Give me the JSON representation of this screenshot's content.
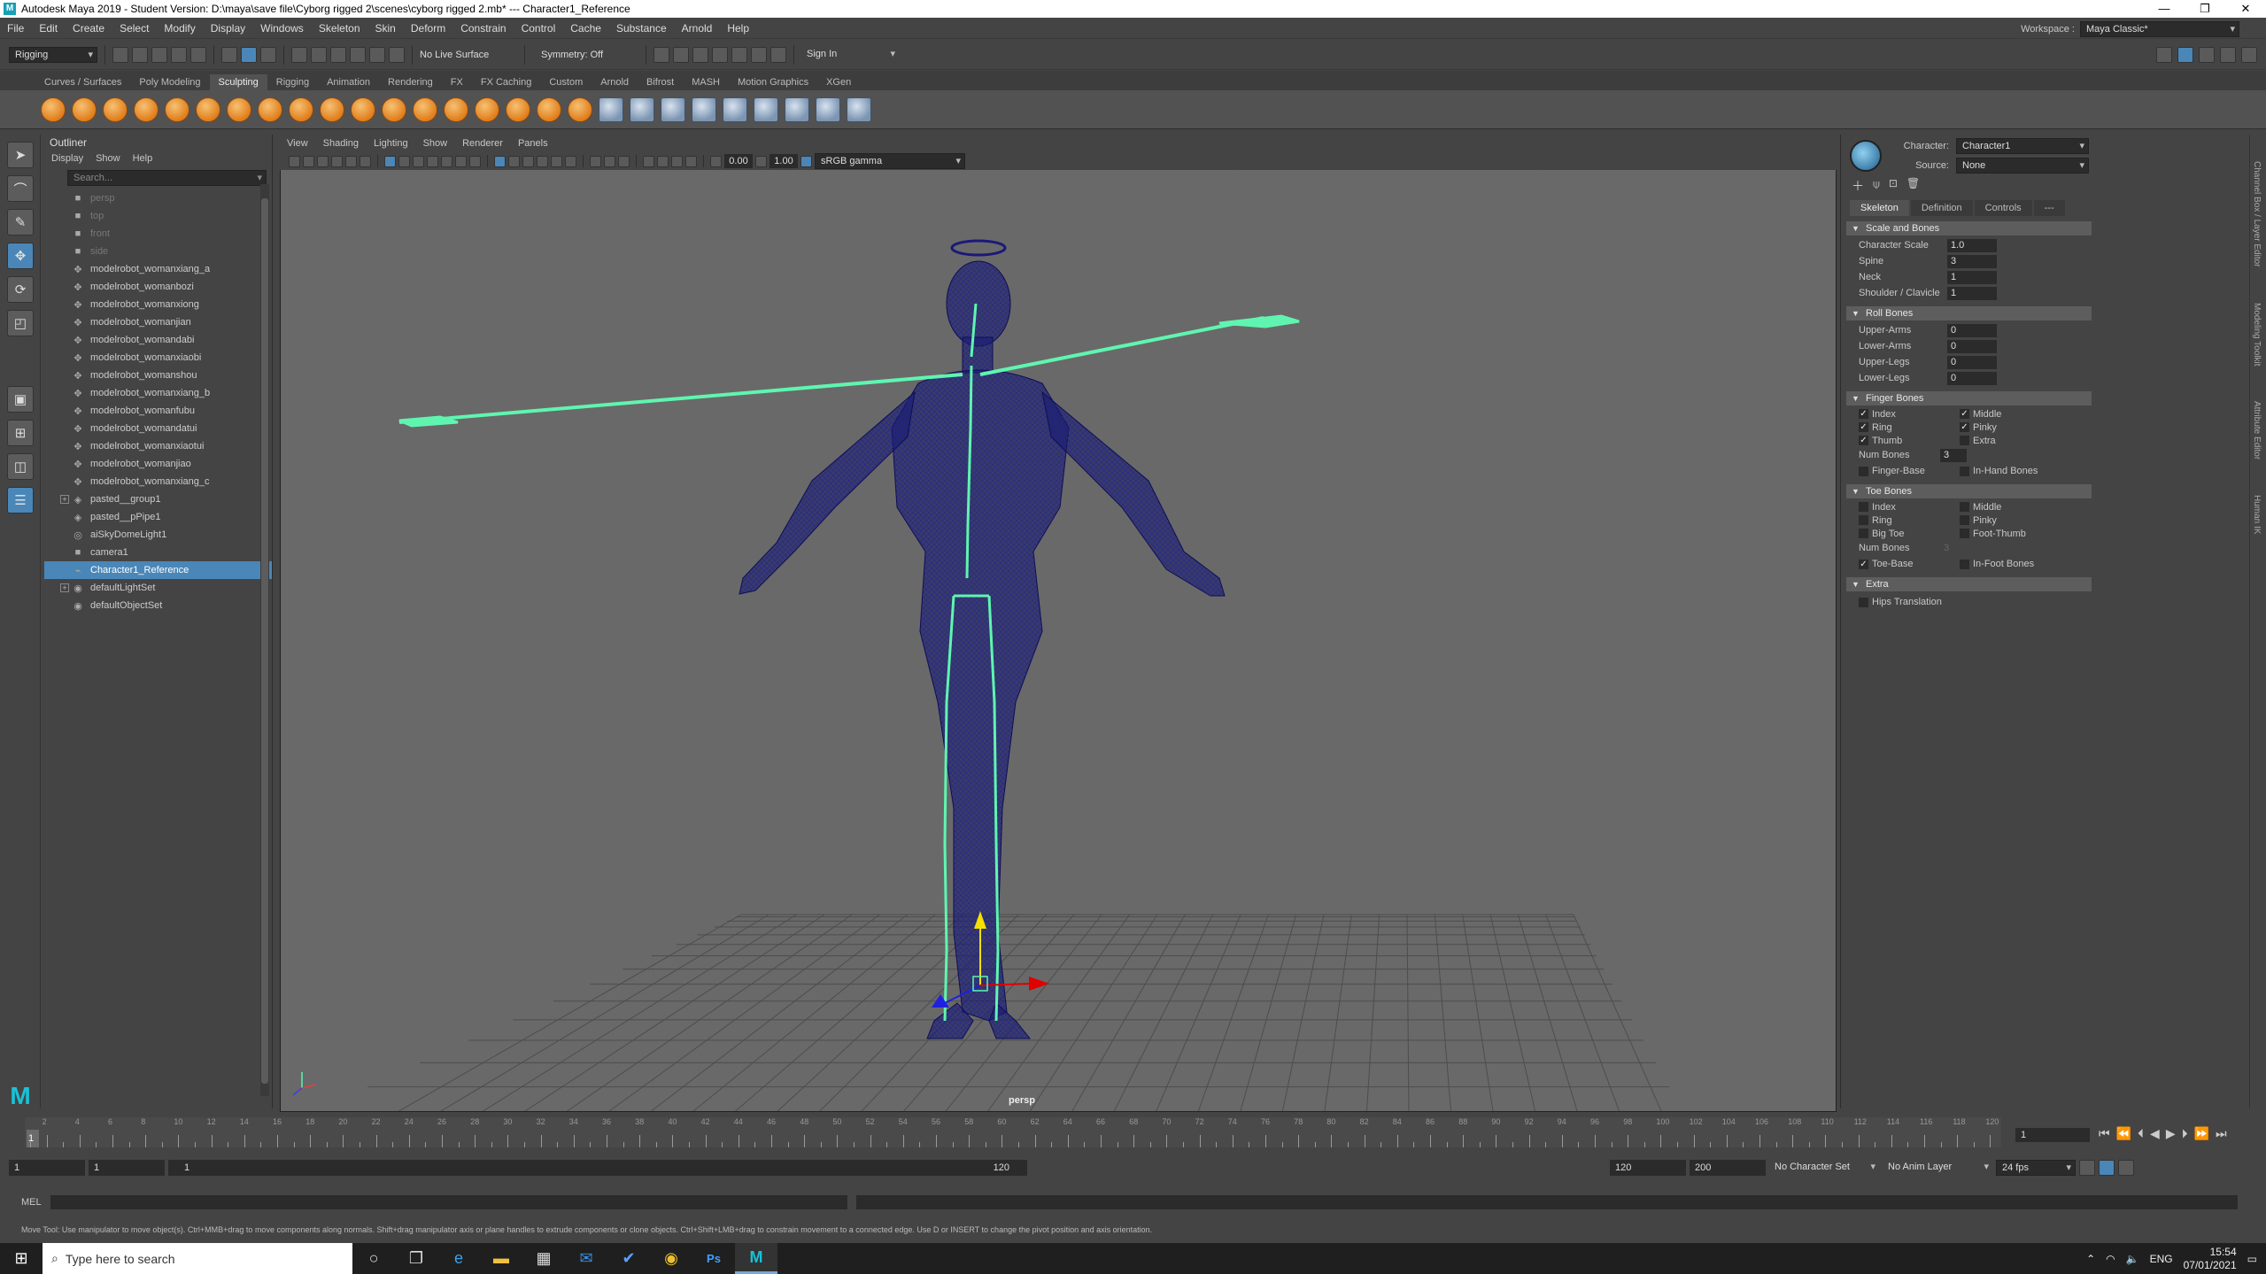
{
  "title_bar": {
    "text": "Autodesk Maya 2019 - Student Version: D:\\maya\\save file\\Cyborg rigged 2\\scenes\\cyborg rigged 2.mb*   ---   Character1_Reference",
    "minimize": "—",
    "maximize": "❐",
    "close": "✕"
  },
  "menu": [
    "File",
    "Edit",
    "Create",
    "Select",
    "Modify",
    "Display",
    "Windows",
    "Skeleton",
    "Skin",
    "Deform",
    "Constrain",
    "Control",
    "Cache",
    "Substance",
    "Arnold",
    "Help"
  ],
  "workspace": {
    "label": "Workspace :",
    "value": "Maya Classic*"
  },
  "status_line": {
    "mode": "Rigging",
    "live_surface": "No Live Surface",
    "symmetry": "Symmetry: Off",
    "sign_in": "Sign In"
  },
  "shelf_tabs": [
    "Curves / Surfaces",
    "Poly Modeling",
    "Sculpting",
    "Rigging",
    "Animation",
    "Rendering",
    "FX",
    "FX Caching",
    "Custom",
    "Arnold",
    "Bifrost",
    "MASH",
    "Motion Graphics",
    "XGen"
  ],
  "shelf_active": "Sculpting",
  "outliner": {
    "title": "Outliner",
    "menus": [
      "Display",
      "Show",
      "Help"
    ],
    "search_placeholder": "Search...",
    "items": [
      {
        "label": "persp",
        "icon": "camera-icon",
        "dim": true
      },
      {
        "label": "top",
        "icon": "camera-icon",
        "dim": true
      },
      {
        "label": "front",
        "icon": "camera-icon",
        "dim": true
      },
      {
        "label": "side",
        "icon": "camera-icon",
        "dim": true
      },
      {
        "label": "modelrobot_womanxiang_a",
        "icon": "mesh-icon"
      },
      {
        "label": "modelrobot_womanbozi",
        "icon": "mesh-icon"
      },
      {
        "label": "modelrobot_womanxiong",
        "icon": "mesh-icon"
      },
      {
        "label": "modelrobot_womanjian",
        "icon": "mesh-icon"
      },
      {
        "label": "modelrobot_womandabi",
        "icon": "mesh-icon"
      },
      {
        "label": "modelrobot_womanxiaobi",
        "icon": "mesh-icon"
      },
      {
        "label": "modelrobot_womanshou",
        "icon": "mesh-icon"
      },
      {
        "label": "modelrobot_womanxiang_b",
        "icon": "mesh-icon"
      },
      {
        "label": "modelrobot_womanfubu",
        "icon": "mesh-icon"
      },
      {
        "label": "modelrobot_womandatui",
        "icon": "mesh-icon"
      },
      {
        "label": "modelrobot_womanxiaotui",
        "icon": "mesh-icon"
      },
      {
        "label": "modelrobot_womanjiao",
        "icon": "mesh-icon"
      },
      {
        "label": "modelrobot_womanxiang_c",
        "icon": "mesh-icon"
      },
      {
        "label": "pasted__group1",
        "icon": "group-icon",
        "expand": true
      },
      {
        "label": "pasted__pPipe1",
        "icon": "group-icon"
      },
      {
        "label": "aiSkyDomeLight1",
        "icon": "light-icon"
      },
      {
        "label": "camera1",
        "icon": "camera-icon"
      },
      {
        "label": "Character1_Reference",
        "icon": "joint-icon",
        "selected": true
      },
      {
        "label": "defaultLightSet",
        "icon": "set-icon",
        "expand": true
      },
      {
        "label": "defaultObjectSet",
        "icon": "set-icon"
      }
    ]
  },
  "viewport": {
    "menus": [
      "View",
      "Shading",
      "Lighting",
      "Show",
      "Renderer",
      "Panels"
    ],
    "exposure": "0.00",
    "gamma": "1.00",
    "color_space": "sRGB gamma",
    "camera_label": "persp"
  },
  "hik": {
    "character_label": "Character:",
    "character_value": "Character1",
    "source_label": "Source:",
    "source_value": "None",
    "tabs": [
      "Skeleton",
      "Definition",
      "Controls",
      "---"
    ],
    "scale_bones": {
      "title": "Scale and Bones",
      "fields": [
        {
          "label": "Character Scale",
          "value": "1.0"
        },
        {
          "label": "Spine",
          "value": "3"
        },
        {
          "label": "Neck",
          "value": "1"
        },
        {
          "label": "Shoulder / Clavicle",
          "value": "1"
        }
      ]
    },
    "roll_bones": {
      "title": "Roll Bones",
      "fields": [
        {
          "label": "Upper-Arms",
          "value": "0"
        },
        {
          "label": "Lower-Arms",
          "value": "0"
        },
        {
          "label": "Upper-Legs",
          "value": "0"
        },
        {
          "label": "Lower-Legs",
          "value": "0"
        }
      ]
    },
    "finger_bones": {
      "title": "Finger Bones",
      "checks": [
        [
          "Index",
          true,
          "Middle",
          true
        ],
        [
          "Ring",
          true,
          "Pinky",
          true
        ],
        [
          "Thumb",
          true,
          "Extra",
          false
        ]
      ],
      "num_label": "Num Bones",
      "num_value": "3",
      "base": [
        "Finger-Base",
        false,
        "In-Hand Bones",
        false
      ]
    },
    "toe_bones": {
      "title": "Toe Bones",
      "checks": [
        [
          "Index",
          false,
          "Middle",
          false
        ],
        [
          "Ring",
          false,
          "Pinky",
          false
        ],
        [
          "Big Toe",
          false,
          "Foot-Thumb",
          false
        ]
      ],
      "num_label": "Num Bones",
      "num_value": "3",
      "base": [
        "Toe-Base",
        true,
        "In-Foot Bones",
        false
      ]
    },
    "extra": {
      "title": "Extra",
      "check": "Hips Translation"
    }
  },
  "right_strip": [
    "Channel Box / Layer Editor",
    "Modeling Toolkit",
    "Attribute Editor",
    "Human IK"
  ],
  "timeline": {
    "start": 1,
    "end": 120,
    "step": 2,
    "current_frame": "1"
  },
  "range": {
    "start1": "1",
    "start2": "1",
    "slider_start": "1",
    "slider_end": "120",
    "end1": "120",
    "end2": "200",
    "char_set": "No Character Set",
    "anim_layer": "No Anim Layer",
    "fps": "24 fps"
  },
  "mel": {
    "label": "MEL"
  },
  "help_line": "Move Tool: Use manipulator to move object(s). Ctrl+MMB+drag to move components along normals. Shift+drag manipulator axis or plane handles to extrude components or clone objects. Ctrl+Shift+LMB+drag to constrain movement to a connected edge. Use D or INSERT to change the pivot position and axis orientation.",
  "taskbar": {
    "search_placeholder": "Type here to search",
    "language": "ENG",
    "time": "15:54",
    "date": "07/01/2021"
  },
  "colors": {
    "mesh": "#1a1a7a",
    "skeleton": "#5ff5b0",
    "selection": "#4a87b8",
    "viewport_bg": "#696969"
  }
}
